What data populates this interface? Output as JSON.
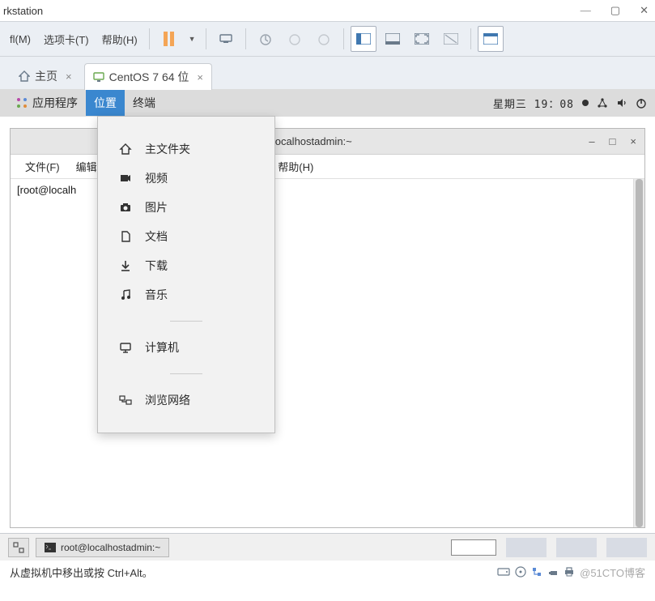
{
  "outerWindow": {
    "title": "rkstation"
  },
  "toolbar": {
    "menu1": "fl(M)",
    "menu2": "选项卡(T)",
    "menu3": "帮助(H)"
  },
  "tabs": {
    "home": "主页",
    "vm": "CentOS 7 64 位"
  },
  "gnomePanel": {
    "apps": "应用程序",
    "places": "位置",
    "terminal": "终端",
    "datetime": "星期三 19：08"
  },
  "dropdown": {
    "home": "主文件夹",
    "video": "视频",
    "pictures": "图片",
    "documents": "文档",
    "downloads": "下载",
    "music": "音乐",
    "computer": "计算机",
    "browse": "浏览网络"
  },
  "terminal": {
    "title": "oot@localhostadmin:~",
    "menu": {
      "file": "文件(F)",
      "edit": "编辑(",
      "help": "帮助(H)"
    },
    "prompt": "[root@localh"
  },
  "taskbar": {
    "task1": "root@localhostadmin:~"
  },
  "statusLine": {
    "hint": "从虚拟机中移出或按 Ctrl+Alt。",
    "watermark": "@51CTO博客"
  }
}
